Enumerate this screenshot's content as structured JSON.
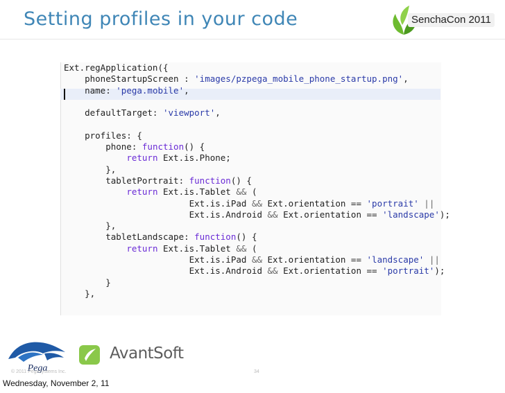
{
  "slide": {
    "title": "Setting profiles in your code",
    "event_badge": "SenchaCon 2011",
    "copyright": "© 2011 Pegasystems Inc.",
    "page_number": "34",
    "footer_date": "Wednesday, November 2, 11"
  },
  "logos": {
    "sencha": "sencha-leaf-icon",
    "pega": "Pega",
    "avantsoft": "AvantSoft"
  },
  "colors": {
    "title": "#3f86b6",
    "keyword": "#6a2bd6",
    "string": "#2a3aa8",
    "highlight_line": "#e9eef9"
  },
  "code": {
    "lines": [
      [
        {
          "t": "Ext.regApplication({",
          "c": ""
        }
      ],
      [
        {
          "t": "    phoneStartupScreen : ",
          "c": ""
        },
        {
          "t": "'images/pzpega_mobile_phone_startup.png'",
          "c": "str"
        },
        {
          "t": ",",
          "c": ""
        }
      ],
      [
        {
          "t": "    name: ",
          "c": ""
        },
        {
          "t": "'pega.mobile'",
          "c": "str"
        },
        {
          "t": ",",
          "c": ""
        }
      ],
      [
        {
          "t": "",
          "c": ""
        }
      ],
      [
        {
          "t": "    defaultTarget: ",
          "c": ""
        },
        {
          "t": "'viewport'",
          "c": "str"
        },
        {
          "t": ",",
          "c": ""
        }
      ],
      [
        {
          "t": "",
          "c": ""
        }
      ],
      [
        {
          "t": "    profiles: {",
          "c": ""
        }
      ],
      [
        {
          "t": "        phone: ",
          "c": ""
        },
        {
          "t": "function",
          "c": "kw"
        },
        {
          "t": "() {",
          "c": ""
        }
      ],
      [
        {
          "t": "            ",
          "c": ""
        },
        {
          "t": "return",
          "c": "kw"
        },
        {
          "t": " Ext.is.Phone;",
          "c": ""
        }
      ],
      [
        {
          "t": "        },",
          "c": ""
        }
      ],
      [
        {
          "t": "        tabletPortrait: ",
          "c": ""
        },
        {
          "t": "function",
          "c": "kw"
        },
        {
          "t": "() {",
          "c": ""
        }
      ],
      [
        {
          "t": "            ",
          "c": ""
        },
        {
          "t": "return",
          "c": "kw"
        },
        {
          "t": " Ext.is.Tablet ",
          "c": ""
        },
        {
          "t": "&&",
          "c": "op"
        },
        {
          "t": " (",
          "c": ""
        }
      ],
      [
        {
          "t": "                        Ext.is.iPad ",
          "c": ""
        },
        {
          "t": "&&",
          "c": "op"
        },
        {
          "t": " Ext.orientation == ",
          "c": ""
        },
        {
          "t": "'portrait'",
          "c": "str"
        },
        {
          "t": " ||",
          "c": "op"
        }
      ],
      [
        {
          "t": "                        Ext.is.Android ",
          "c": ""
        },
        {
          "t": "&&",
          "c": "op"
        },
        {
          "t": " Ext.orientation == ",
          "c": ""
        },
        {
          "t": "'landscape'",
          "c": "str"
        },
        {
          "t": ");",
          "c": ""
        }
      ],
      [
        {
          "t": "        },",
          "c": ""
        }
      ],
      [
        {
          "t": "        tabletLandscape: ",
          "c": ""
        },
        {
          "t": "function",
          "c": "kw"
        },
        {
          "t": "() {",
          "c": ""
        }
      ],
      [
        {
          "t": "            ",
          "c": ""
        },
        {
          "t": "return",
          "c": "kw"
        },
        {
          "t": " Ext.is.Tablet ",
          "c": ""
        },
        {
          "t": "&&",
          "c": "op"
        },
        {
          "t": " (",
          "c": ""
        }
      ],
      [
        {
          "t": "                        Ext.is.iPad ",
          "c": ""
        },
        {
          "t": "&&",
          "c": "op"
        },
        {
          "t": " Ext.orientation == ",
          "c": ""
        },
        {
          "t": "'landscape'",
          "c": "str"
        },
        {
          "t": " ||",
          "c": "op"
        }
      ],
      [
        {
          "t": "                        Ext.is.Android ",
          "c": ""
        },
        {
          "t": "&&",
          "c": "op"
        },
        {
          "t": " Ext.orientation == ",
          "c": ""
        },
        {
          "t": "'portrait'",
          "c": "str"
        },
        {
          "t": ");",
          "c": ""
        }
      ],
      [
        {
          "t": "        }",
          "c": ""
        }
      ],
      [
        {
          "t": "    },",
          "c": ""
        }
      ]
    ]
  }
}
